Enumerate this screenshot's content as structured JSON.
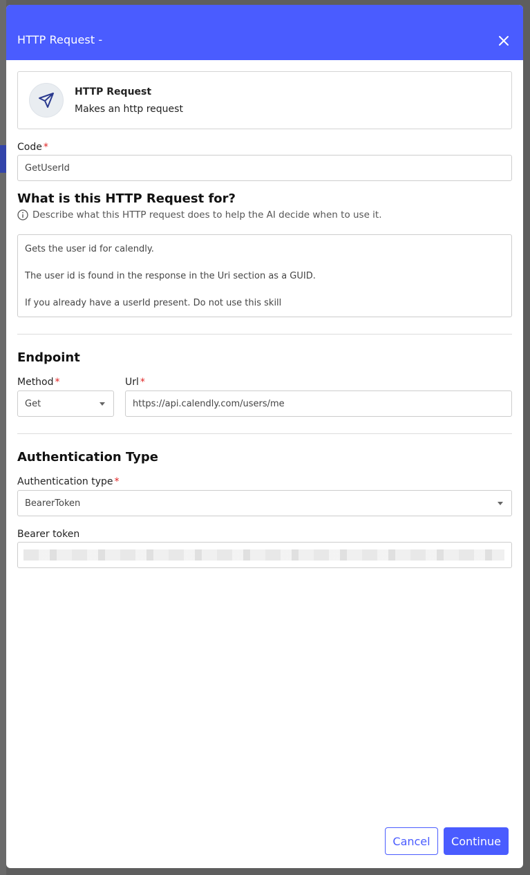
{
  "modal": {
    "title": "HTTP Request -",
    "close_icon": "close-icon"
  },
  "info_card": {
    "icon": "paper-plane-icon",
    "name": "HTTP Request",
    "description": "Makes an http request"
  },
  "code": {
    "label": "Code",
    "required_mark": "*",
    "value": "GetUserId"
  },
  "purpose": {
    "heading": "What is this HTTP Request for?",
    "hint_icon": "info-circle-icon",
    "hint": "Describe what this HTTP request does to help the AI decide when to use it.",
    "lines": [
      "Gets the user id for calendly.",
      "",
      "The user id is found in the response in the Uri section as a GUID.",
      "",
      "If you already have a userId present. Do not use this skill"
    ]
  },
  "endpoint": {
    "heading": "Endpoint",
    "method_label": "Method",
    "method_value": "Get",
    "url_label": "Url",
    "url_value": "https://api.calendly.com/users/me",
    "required_mark": "*"
  },
  "auth": {
    "heading": "Authentication Type",
    "type_label": "Authentication type",
    "type_value": "BearerToken",
    "required_mark": "*",
    "token_label": "Bearer token"
  },
  "footer": {
    "cancel_label": "Cancel",
    "continue_label": "Continue"
  },
  "colors": {
    "accent": "#4a5cff",
    "required": "#e02424"
  }
}
